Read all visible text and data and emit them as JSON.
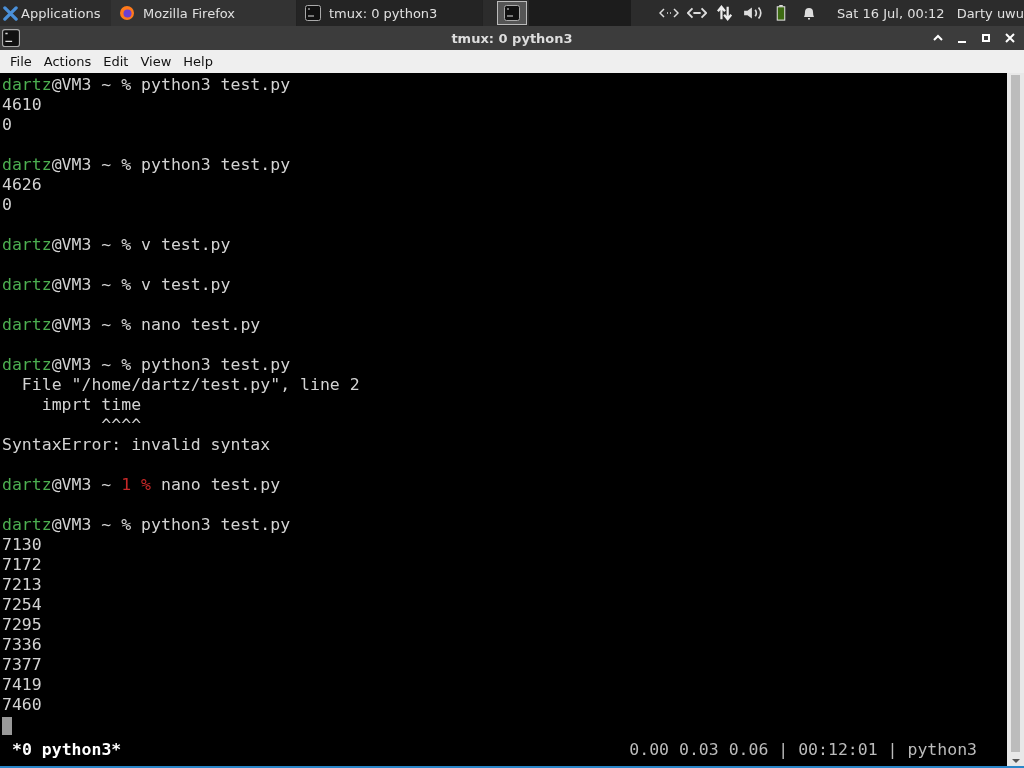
{
  "panel": {
    "applications": "Applications",
    "tasks": [
      {
        "label": "Mozilla Firefox",
        "kind": "browser",
        "selected": false
      },
      {
        "label": "tmux: 0 python3",
        "kind": "terminal",
        "selected": true
      }
    ],
    "clock": "Sat 16 Jul, 00:12",
    "user": "Darty uwu"
  },
  "window": {
    "title": "tmux: 0 python3"
  },
  "menu": [
    "File",
    "Actions",
    "Edit",
    "View",
    "Help"
  ],
  "terminal": {
    "lines": [
      {
        "kind": "text",
        "segments": [
          {
            "text": "dartz",
            "color": "#4caf50"
          },
          {
            "text": "@VM3 ~ % python3 test.py",
            "color": "#d3d3d3"
          }
        ]
      },
      {
        "kind": "text",
        "segments": [
          {
            "text": "4610",
            "color": "#d3d3d3"
          }
        ]
      },
      {
        "kind": "text",
        "segments": [
          {
            "text": "0",
            "color": "#d3d3d3"
          }
        ]
      },
      {
        "kind": "blank"
      },
      {
        "kind": "text",
        "segments": [
          {
            "text": "dartz",
            "color": "#4caf50"
          },
          {
            "text": "@VM3 ~ % python3 test.py",
            "color": "#d3d3d3"
          }
        ]
      },
      {
        "kind": "text",
        "segments": [
          {
            "text": "4626",
            "color": "#d3d3d3"
          }
        ]
      },
      {
        "kind": "text",
        "segments": [
          {
            "text": "0",
            "color": "#d3d3d3"
          }
        ]
      },
      {
        "kind": "blank"
      },
      {
        "kind": "text",
        "segments": [
          {
            "text": "dartz",
            "color": "#4caf50"
          },
          {
            "text": "@VM3 ~ % v test.py",
            "color": "#d3d3d3"
          }
        ]
      },
      {
        "kind": "blank"
      },
      {
        "kind": "text",
        "segments": [
          {
            "text": "dartz",
            "color": "#4caf50"
          },
          {
            "text": "@VM3 ~ % v test.py",
            "color": "#d3d3d3"
          }
        ]
      },
      {
        "kind": "blank"
      },
      {
        "kind": "text",
        "segments": [
          {
            "text": "dartz",
            "color": "#4caf50"
          },
          {
            "text": "@VM3 ~ % nano test.py",
            "color": "#d3d3d3"
          }
        ]
      },
      {
        "kind": "blank"
      },
      {
        "kind": "text",
        "segments": [
          {
            "text": "dartz",
            "color": "#4caf50"
          },
          {
            "text": "@VM3 ~ % python3 test.py",
            "color": "#d3d3d3"
          }
        ]
      },
      {
        "kind": "text",
        "segments": [
          {
            "text": "  File \"/home/dartz/test.py\", line 2",
            "color": "#d3d3d3"
          }
        ]
      },
      {
        "kind": "text",
        "segments": [
          {
            "text": "    imprt time",
            "color": "#d3d3d3"
          }
        ]
      },
      {
        "kind": "text",
        "segments": [
          {
            "text": "          ^^^^",
            "color": "#d3d3d3"
          }
        ]
      },
      {
        "kind": "text",
        "segments": [
          {
            "text": "SyntaxError: invalid syntax",
            "color": "#d3d3d3"
          }
        ]
      },
      {
        "kind": "blank"
      },
      {
        "kind": "text",
        "segments": [
          {
            "text": "dartz",
            "color": "#4caf50"
          },
          {
            "text": "@VM3 ~ ",
            "color": "#d3d3d3"
          },
          {
            "text": "1 %",
            "color": "#c62828"
          },
          {
            "text": " nano test.py",
            "color": "#d3d3d3"
          }
        ]
      },
      {
        "kind": "blank"
      },
      {
        "kind": "text",
        "segments": [
          {
            "text": "dartz",
            "color": "#4caf50"
          },
          {
            "text": "@VM3 ~ % python3 test.py",
            "color": "#d3d3d3"
          }
        ]
      },
      {
        "kind": "text",
        "segments": [
          {
            "text": "7130",
            "color": "#d3d3d3"
          }
        ]
      },
      {
        "kind": "text",
        "segments": [
          {
            "text": "7172",
            "color": "#d3d3d3"
          }
        ]
      },
      {
        "kind": "text",
        "segments": [
          {
            "text": "7213",
            "color": "#d3d3d3"
          }
        ]
      },
      {
        "kind": "text",
        "segments": [
          {
            "text": "7254",
            "color": "#d3d3d3"
          }
        ]
      },
      {
        "kind": "text",
        "segments": [
          {
            "text": "7295",
            "color": "#d3d3d3"
          }
        ]
      },
      {
        "kind": "text",
        "segments": [
          {
            "text": "7336",
            "color": "#d3d3d3"
          }
        ]
      },
      {
        "kind": "text",
        "segments": [
          {
            "text": "7377",
            "color": "#d3d3d3"
          }
        ]
      },
      {
        "kind": "text",
        "segments": [
          {
            "text": "7419",
            "color": "#d3d3d3"
          }
        ]
      },
      {
        "kind": "text",
        "segments": [
          {
            "text": "7460",
            "color": "#d3d3d3"
          }
        ]
      },
      {
        "kind": "cursor"
      }
    ],
    "status_left": "*0 python3*",
    "status_right": "0.00 0.03 0.06 | 00:12:01 | python3"
  }
}
